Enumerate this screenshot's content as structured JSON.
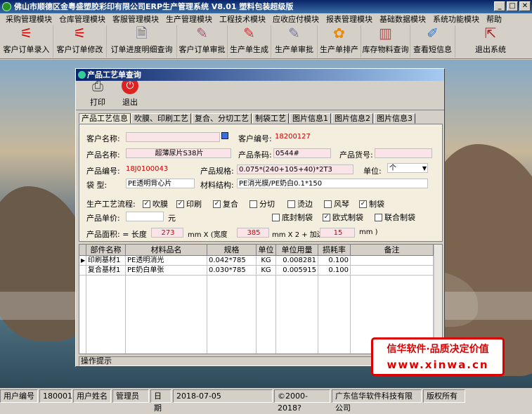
{
  "app": {
    "title": "佛山市顺德区金粤盛塑胶彩印有限公司ERP生产管理系统   V8.01  塑料包装超级版"
  },
  "menu": [
    "采购管理模块",
    "仓库管理模块",
    "客服管理模块",
    "生产管理模块",
    "工程技术模块",
    "应收应付模块",
    "报表管理模块",
    "基础数据模块",
    "系统功能模块",
    "帮助"
  ],
  "toolbar": [
    {
      "label": "客户订单录入",
      "icon": "pdf-icon",
      "w": 68
    },
    {
      "label": "客户订单修改",
      "icon": "pdf-icon",
      "w": 82
    },
    {
      "label": "订单进度明细查询",
      "icon": "document-search-icon",
      "w": 100
    },
    {
      "label": "客户订单审批",
      "icon": "approve-icon",
      "w": 72
    },
    {
      "label": "生产单生成",
      "icon": "generate-icon",
      "w": 62
    },
    {
      "label": "生产单审批",
      "icon": "approve-icon",
      "w": 64
    },
    {
      "label": "生产单排产",
      "icon": "schedule-icon",
      "w": 60
    },
    {
      "label": "库存物料查询",
      "icon": "inventory-icon",
      "w": 70
    },
    {
      "label": "查看短信息",
      "icon": "message-icon",
      "w": 62
    },
    {
      "label": "退出系统",
      "icon": "exit-icon",
      "w": 100
    }
  ],
  "status": {
    "user_id_label": "用户编号",
    "user_id": "180001",
    "user_name_label": "用户姓名",
    "user_name": "管理员",
    "date_label": "日期",
    "date": "2018-07-05",
    "copyright": "©2000-2018?",
    "company": "广东信华软件科技有限公司",
    "rights": "版权所有"
  },
  "dialog": {
    "title": "产品工艺单查询",
    "print_label": "打印",
    "exit_label": "退出",
    "tabs": [
      "产品工艺信息",
      "吹膜、印刷工艺",
      "复合、分切工艺",
      "制袋工艺",
      "图片信息1",
      "图片信息2",
      "图片信息3"
    ],
    "status_label": "操作提示"
  },
  "form": {
    "customer_name_label": "客户名称:",
    "customer_name": "",
    "customer_no_label": "客户编号:",
    "customer_no": "18200127",
    "product_name_label": "产品名称:",
    "product_name": "超薄尿片S38片",
    "barcode_label": "产品条码:",
    "barcode": "0544#",
    "product_item_label": "产品货号:",
    "product_item": "",
    "product_no_label": "产品编号:",
    "product_no": "18J0100043",
    "spec_label": "产品规格:",
    "spec": "0.075*(240+105+40)*2T3",
    "unit_label": "单位:",
    "unit": "个",
    "bag_type_label": "袋  型:",
    "bag_type": "PE透明背心片",
    "material_label": "材料结构:",
    "material": "PE消光膜/PE奶白0.1*150",
    "process_label": "生产工艺流程:",
    "price_label": "产品单价:",
    "price": "",
    "price_unit": "元",
    "area_label": "产品面积: =  长度",
    "length": "273",
    "mm_x_width": "mm X (宽度",
    "width": "385",
    "mm_x2_add": "mm X 2 + 加边",
    "add_edge": "15",
    "mm_close": "mm )"
  },
  "checks": [
    {
      "label": "吹膜",
      "checked": true
    },
    {
      "label": "印刷",
      "checked": true
    },
    {
      "label": "复合",
      "checked": true
    },
    {
      "label": "分切",
      "checked": false
    },
    {
      "label": "烫边",
      "checked": false
    },
    {
      "label": "风琴",
      "checked": false
    },
    {
      "label": "制袋",
      "checked": true
    },
    {
      "label": "底封制袋",
      "checked": false
    },
    {
      "label": "欧式制袋",
      "checked": true
    },
    {
      "label": "联合制袋",
      "checked": false
    }
  ],
  "grid": {
    "headers": [
      "部件名称",
      "材料品名",
      "规格",
      "单位",
      "单位用量",
      "损耗率",
      "备注"
    ],
    "rows": [
      [
        "印刷基材1",
        "PE透明消光",
        "0.042*785",
        "KG",
        "0.008281",
        "0.100",
        ""
      ],
      [
        "复合基材1",
        "PE奶白单张",
        "0.030*785",
        "KG",
        "0.005915",
        "0.100",
        ""
      ]
    ]
  },
  "watermark": {
    "line1": "信华软件·品质决定价值",
    "line2": "www.xinwa.cn"
  }
}
